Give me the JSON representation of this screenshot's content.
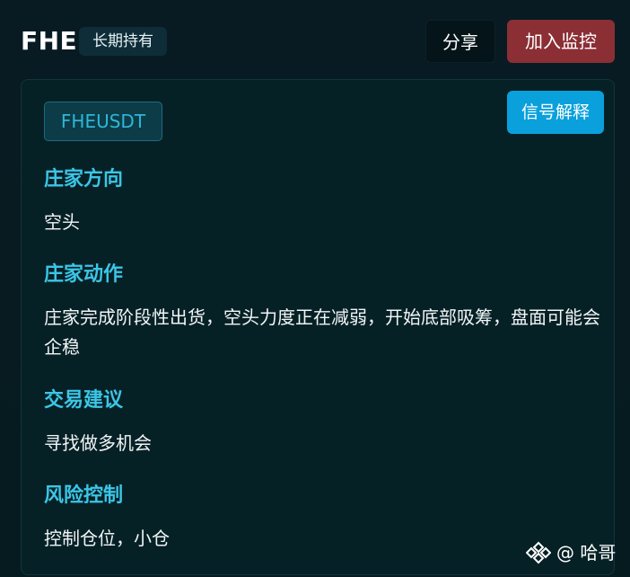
{
  "header": {
    "title": "FHE",
    "hold_badge": "长期持有",
    "share_label": "分享",
    "monitor_label": "加入监控"
  },
  "card": {
    "symbol": "FHEUSDT",
    "explain_label": "信号解释",
    "sections": [
      {
        "title": "庄家方向",
        "text": "空头"
      },
      {
        "title": "庄家动作",
        "text": "庄家完成阶段性出货，空头力度正在减弱，开始底部吸筹，盘面可能会企稳"
      },
      {
        "title": "交易建议",
        "text": "寻找做多机会"
      },
      {
        "title": "风险控制",
        "text": "控制仓位，小仓"
      }
    ]
  },
  "watermark": {
    "logo_icon": "binance-diamond-icon",
    "handle": "@ 哈哥"
  },
  "colors": {
    "background": "#061a20",
    "card": "#062126",
    "accent_cyan": "#3cc5e6",
    "explain_blue": "#0aa0dc",
    "monitor_red": "#8b2f35",
    "symbol_text": "#2fb6d6"
  }
}
